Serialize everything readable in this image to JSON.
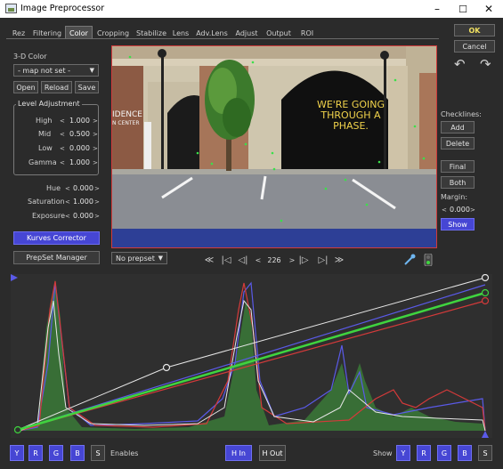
{
  "window": {
    "title": "Image Preprocessor",
    "controls": [
      "–",
      "☐",
      "✕"
    ]
  },
  "tabs": [
    "Rez",
    "Filtering",
    "Color",
    "Cropping",
    "Stabilize",
    "Lens",
    "Adv.Lens",
    "Adjust",
    "Output",
    "ROI"
  ],
  "active_tab": "Color",
  "left": {
    "color3d_label": "3-D Color",
    "map_select": "- map not set -",
    "open": "Open",
    "reload": "Reload",
    "save": "Save",
    "level_title": "Level Adjustment",
    "levels": [
      {
        "label": "High",
        "value": "1.000"
      },
      {
        "label": "Mid",
        "value": "0.500"
      },
      {
        "label": "Low",
        "value": "0.000"
      },
      {
        "label": "Gamma",
        "value": "1.000"
      }
    ],
    "adjust": [
      {
        "label": "Hue",
        "value": "0.000"
      },
      {
        "label": "Saturation",
        "value": "1.000"
      },
      {
        "label": "Exposure",
        "value": "0.000"
      }
    ],
    "kurves": "Kurves Corrector",
    "prepset_manager": "PrepSet Manager",
    "prepset_select": "No prepset",
    "arrow_left": "<",
    "arrow_right": ">"
  },
  "preview": {
    "sign_line1": "WE'RE GOING",
    "sign_line2": "THROUGH A PHASE.",
    "store_line1": "IDENCE",
    "store_line2": "N CENTER"
  },
  "nav": {
    "frame": "226",
    "first": "≪",
    "start": "|◁",
    "prev": "◁|",
    "lt": "<",
    "gt": ">",
    "next": "|▷",
    "end": "▷|",
    "last": "≫"
  },
  "right": {
    "ok": "OK",
    "cancel": "Cancel",
    "undo": "↶",
    "redo": "↷",
    "checklines": "Checklines:",
    "add": "Add",
    "delete": "Delete",
    "final": "Final",
    "both": "Both",
    "margin": "Margin:",
    "margin_value": "0.000",
    "show": "Show"
  },
  "bottom": {
    "channels": [
      "Y",
      "R",
      "G",
      "B",
      "S"
    ],
    "enables": "Enables",
    "h_in": "H In",
    "h_out": "H Out",
    "show": "Show",
    "show_channels": [
      "Y",
      "R",
      "G",
      "B",
      "S"
    ]
  },
  "colors": {
    "accent_blue": "#4646d4",
    "ok_yellow": "#f0e060",
    "curve_green": "#3fd43f",
    "curve_red": "#d43a3a",
    "curve_blue": "#5a5ae8"
  }
}
